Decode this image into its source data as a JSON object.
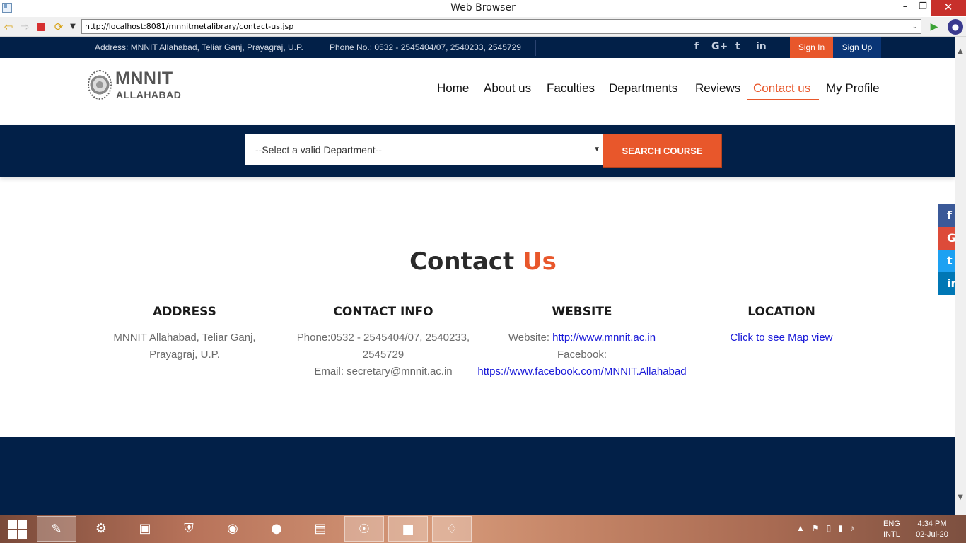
{
  "browser": {
    "title": "Web Browser",
    "url": "http://localhost:8081/mnnitmetalibrary/contact-us.jsp"
  },
  "topbar": {
    "address": "Address: MNNIT Allahabad, Teliar Ganj, Prayagraj, U.P.",
    "phone": "Phone No.: 0532 - 2545404/07, 2540233, 2545729",
    "social": [
      "f",
      "G+",
      "t",
      "in"
    ],
    "signin_label": "Sign In",
    "signup_label": "Sign Up"
  },
  "logo": {
    "name": "MNNIT",
    "sub": "ALLAHABAD"
  },
  "nav": {
    "home": "Home",
    "about": "About us",
    "faculties": "Faculties",
    "departments": "Departments",
    "reviews": "Reviews",
    "contact": "Contact us",
    "profile": "My Profile"
  },
  "search": {
    "select_value": "--Select a valid Department--",
    "button_label": "SEARCH COURSE"
  },
  "contact": {
    "title_main": "Contact",
    "title_accent": "Us",
    "address": {
      "heading": "ADDRESS",
      "line1": "MNNIT Allahabad, Teliar Ganj,",
      "line2": "Prayagraj, U.P."
    },
    "info": {
      "heading": "CONTACT INFO",
      "phone1": "Phone:0532 - 2545404/07, 2540233,",
      "phone2": "2545729",
      "email": "Email: secretary@mnnit.ac.in"
    },
    "website": {
      "heading": "WEBSITE",
      "label": "Website:",
      "url": "http://www.mnnit.ac.in",
      "fb_label": "Facebook:",
      "fb_url": "https://www.facebook.com/MNNIT.Allahabad"
    },
    "location": {
      "heading": "LOCATION",
      "link": "Click to see Map view"
    }
  },
  "side_social": [
    "f",
    "G",
    "t",
    "in"
  ],
  "taskbar": {
    "lang1": "ENG",
    "lang2": "INTL",
    "time": "4:34 PM",
    "date": "02-Jul-20"
  },
  "colors": {
    "navy": "#022048",
    "accent": "#e8572b"
  }
}
